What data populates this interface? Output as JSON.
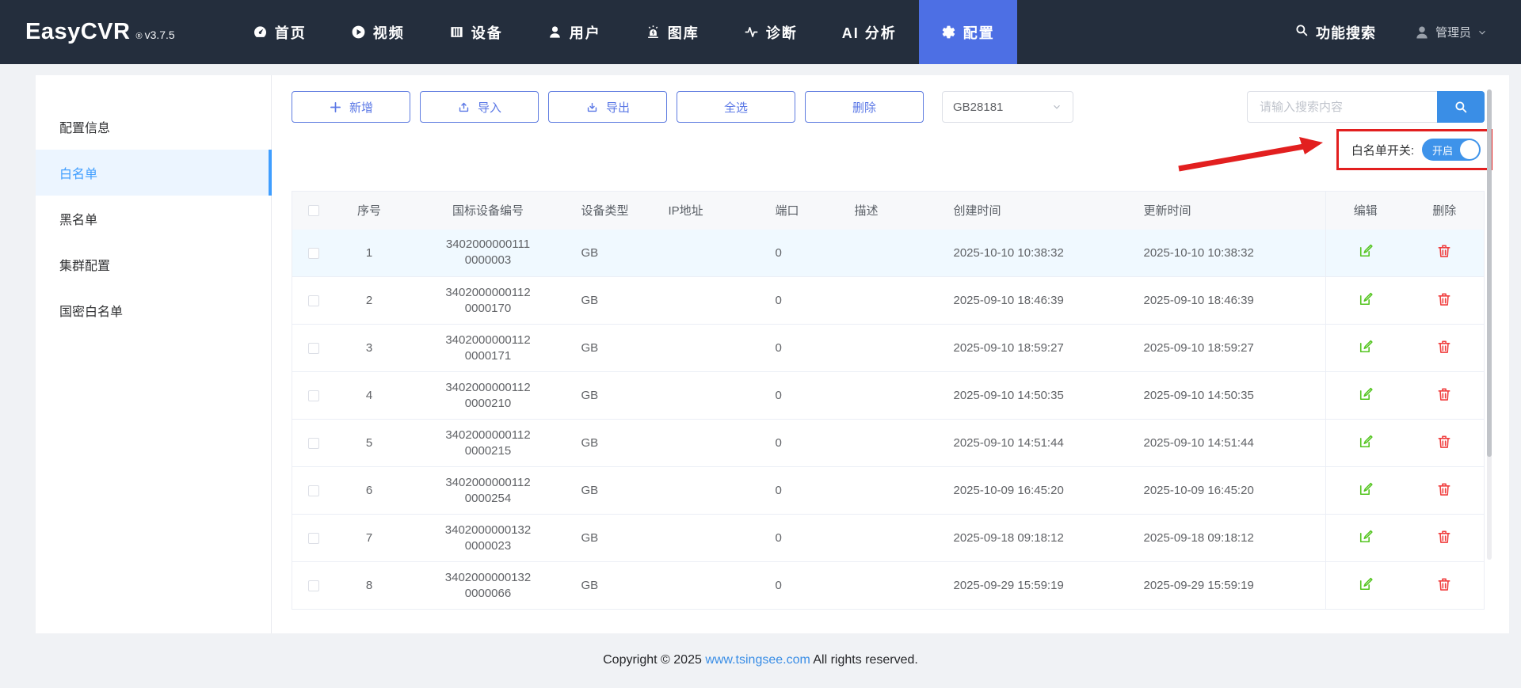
{
  "brand": {
    "name": "EasyCVR",
    "reg": "®",
    "version": "v3.7.5"
  },
  "header": {
    "nav": [
      {
        "icon": "dashboard-icon",
        "label": "首页"
      },
      {
        "icon": "play-circle-icon",
        "label": "视频"
      },
      {
        "icon": "device-icon",
        "label": "设备"
      },
      {
        "icon": "user-icon",
        "label": "用户"
      },
      {
        "icon": "gallery-icon",
        "label": "图库"
      },
      {
        "icon": "diagnosis-icon",
        "label": "诊断"
      },
      {
        "icon": "",
        "label": "AI 分析"
      },
      {
        "icon": "gear-icon",
        "label": "配置",
        "active": true
      }
    ],
    "search_label": "功能搜索",
    "user": {
      "label": "管理员"
    }
  },
  "sidebar": {
    "items": [
      {
        "label": "配置信息"
      },
      {
        "label": "白名单",
        "active": true
      },
      {
        "label": "黑名单"
      },
      {
        "label": "集群配置"
      },
      {
        "label": "国密白名单"
      }
    ]
  },
  "toolbar": {
    "add": "新增",
    "import": "导入",
    "export": "导出",
    "select_all": "全选",
    "delete": "删除",
    "device_type_value": "GB28181",
    "search_placeholder": "请输入搜索内容"
  },
  "whitelist_switch": {
    "label": "白名单开关:",
    "state": "开启"
  },
  "table": {
    "columns": [
      "序号",
      "国标设备编号",
      "设备类型",
      "IP地址",
      "端口",
      "描述",
      "创建时间",
      "更新时间",
      "编辑",
      "删除"
    ],
    "rows": [
      {
        "index": "1",
        "device_id": "3402000000111\n0000003",
        "type": "GB",
        "ip": "",
        "port": "0",
        "desc": "",
        "created": "2025-10-10 10:38:32",
        "updated": "2025-10-10 10:38:32",
        "highlighted": true
      },
      {
        "index": "2",
        "device_id": "3402000000112\n0000170",
        "type": "GB",
        "ip": "",
        "port": "0",
        "desc": "",
        "created": "2025-09-10 18:46:39",
        "updated": "2025-09-10 18:46:39"
      },
      {
        "index": "3",
        "device_id": "3402000000112\n0000171",
        "type": "GB",
        "ip": "",
        "port": "0",
        "desc": "",
        "created": "2025-09-10 18:59:27",
        "updated": "2025-09-10 18:59:27"
      },
      {
        "index": "4",
        "device_id": "3402000000112\n0000210",
        "type": "GB",
        "ip": "",
        "port": "0",
        "desc": "",
        "created": "2025-09-10 14:50:35",
        "updated": "2025-09-10 14:50:35"
      },
      {
        "index": "5",
        "device_id": "3402000000112\n0000215",
        "type": "GB",
        "ip": "",
        "port": "0",
        "desc": "",
        "created": "2025-09-10 14:51:44",
        "updated": "2025-09-10 14:51:44"
      },
      {
        "index": "6",
        "device_id": "3402000000112\n0000254",
        "type": "GB",
        "ip": "",
        "port": "0",
        "desc": "",
        "created": "2025-10-09 16:45:20",
        "updated": "2025-10-09 16:45:20"
      },
      {
        "index": "7",
        "device_id": "3402000000132\n0000023",
        "type": "GB",
        "ip": "",
        "port": "0",
        "desc": "",
        "created": "2025-09-18 09:18:12",
        "updated": "2025-09-18 09:18:12"
      },
      {
        "index": "8",
        "device_id": "3402000000132\n0000066",
        "type": "GB",
        "ip": "",
        "port": "0",
        "desc": "",
        "created": "2025-09-29 15:59:19",
        "updated": "2025-09-29 15:59:19"
      }
    ]
  },
  "footer": {
    "copyright_prefix": "Copyright © 2025",
    "link": "www.tsingsee.com",
    "copyright_suffix": "All rights reserved."
  },
  "colors": {
    "header_bg": "#242e3d",
    "nav_active": "#4d6fe4",
    "primary_blue": "#3a8ee6",
    "sidebar_active": "#409eff",
    "toggle_on": "#3e93ea",
    "annotation_red": "#e21f1f",
    "edit_green": "#53c41f",
    "delete_red": "#f03e3e"
  }
}
